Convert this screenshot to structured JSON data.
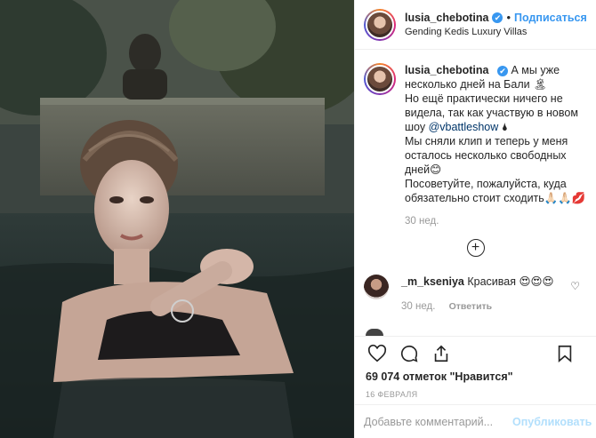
{
  "post": {
    "username": "lusia_chebotina",
    "verified_mark": "✔",
    "separator": "•",
    "follow_label": "Подписаться",
    "location": "Gending Kedis Luxury Villas"
  },
  "caption": {
    "username": "lusia_chebotina",
    "lines": [
      "А мы уже",
      "несколько дней на Бали 🏝",
      "Но ещё практически ничего не",
      "видела, так как участвую в новом"
    ],
    "line5_prefix": "шоу",
    "mention": "@vbattleshow",
    "line5_suffix": "🌢",
    "lines_after": [
      "Мы сняли клип и теперь у меня",
      "осталось несколько свободных",
      "дней😊",
      "Посоветуйте, пожалуйста, куда",
      "обязательно стоит сходить🙏🏻🙏🏻💋"
    ],
    "time": "30 нед."
  },
  "load_more_symbol": "+",
  "comment": {
    "username": "_m_kseniya",
    "text": "Красивая 😍😍😍",
    "time": "30 нед.",
    "reply_label": "Ответить"
  },
  "actions": {
    "icons": [
      "heart-icon",
      "comment-icon",
      "share-icon",
      "bookmark-icon"
    ],
    "likes": "69 074 отметок \"Нравится\"",
    "date": "16 ФЕВРАЛЯ"
  },
  "add_comment": {
    "placeholder": "Добавьте комментарий...",
    "post_label": "Опубликовать"
  },
  "colors": {
    "accent": "#3897f0",
    "post_disabled": "#b2dffc",
    "muted": "#999999"
  }
}
